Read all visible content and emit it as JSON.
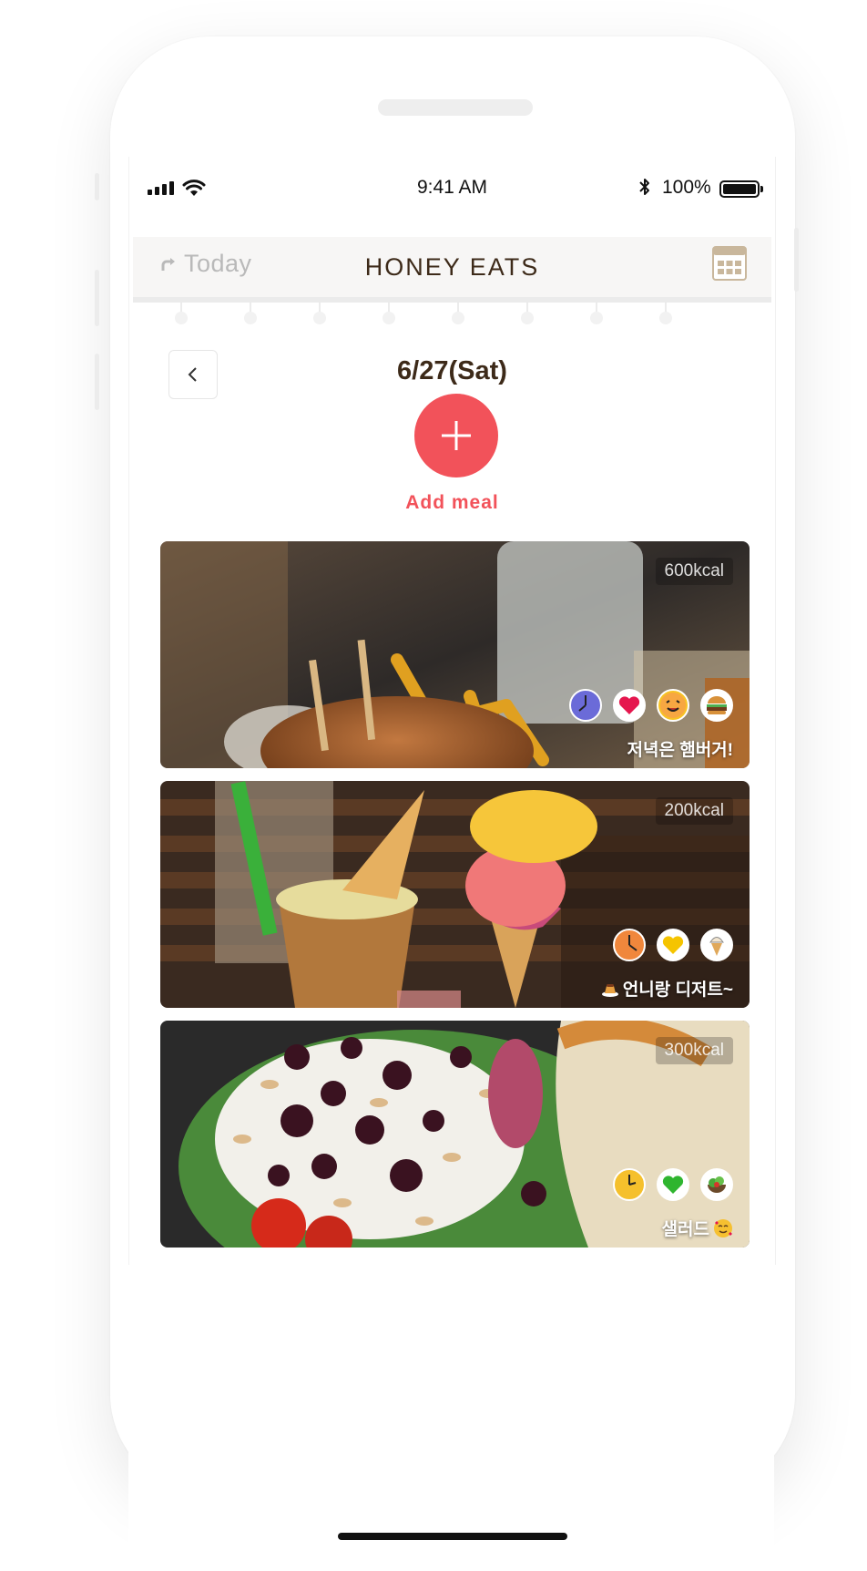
{
  "status_bar": {
    "time": "9:41 AM",
    "battery_percent": "100%",
    "icons": [
      "signal-icon",
      "wifi-icon",
      "bluetooth-icon",
      "battery-icon"
    ]
  },
  "header": {
    "today_label": "Today",
    "title": "HONEY EATS",
    "icons": [
      "share-arrow-icon",
      "calendar-icon"
    ]
  },
  "date_nav": {
    "date": "6/27(Sat)",
    "back_icon": "chevron-left-icon"
  },
  "add_meal": {
    "label": "Add meal",
    "icon": "plus-icon",
    "color": "#f2525a"
  },
  "meals": [
    {
      "kcal": "600kcal",
      "caption": "저녁은 햄버거!",
      "photo": "burger-photo",
      "icons": [
        "clock-icon",
        "heart-icon",
        "happy-face-icon",
        "burger-icon"
      ],
      "clock_color": "#6b6bd8",
      "heart_color": "#e5164e"
    },
    {
      "kcal": "200kcal",
      "caption": "언니랑 디저트~",
      "caption_prefix_icon": "pudding-icon",
      "photo": "ice-cream-photo",
      "icons": [
        "clock-icon",
        "heart-icon",
        "ice-cream-icon"
      ],
      "clock_color": "#f0873c",
      "heart_color": "#f5c400"
    },
    {
      "kcal": "300kcal",
      "caption": "샐러드",
      "caption_suffix_icon": "smiling-face-with-hearts-icon",
      "photo": "salad-photo",
      "icons": [
        "clock-icon",
        "heart-icon",
        "salad-icon"
      ],
      "clock_color": "#f5c02c",
      "heart_color": "#2fb52f"
    }
  ]
}
